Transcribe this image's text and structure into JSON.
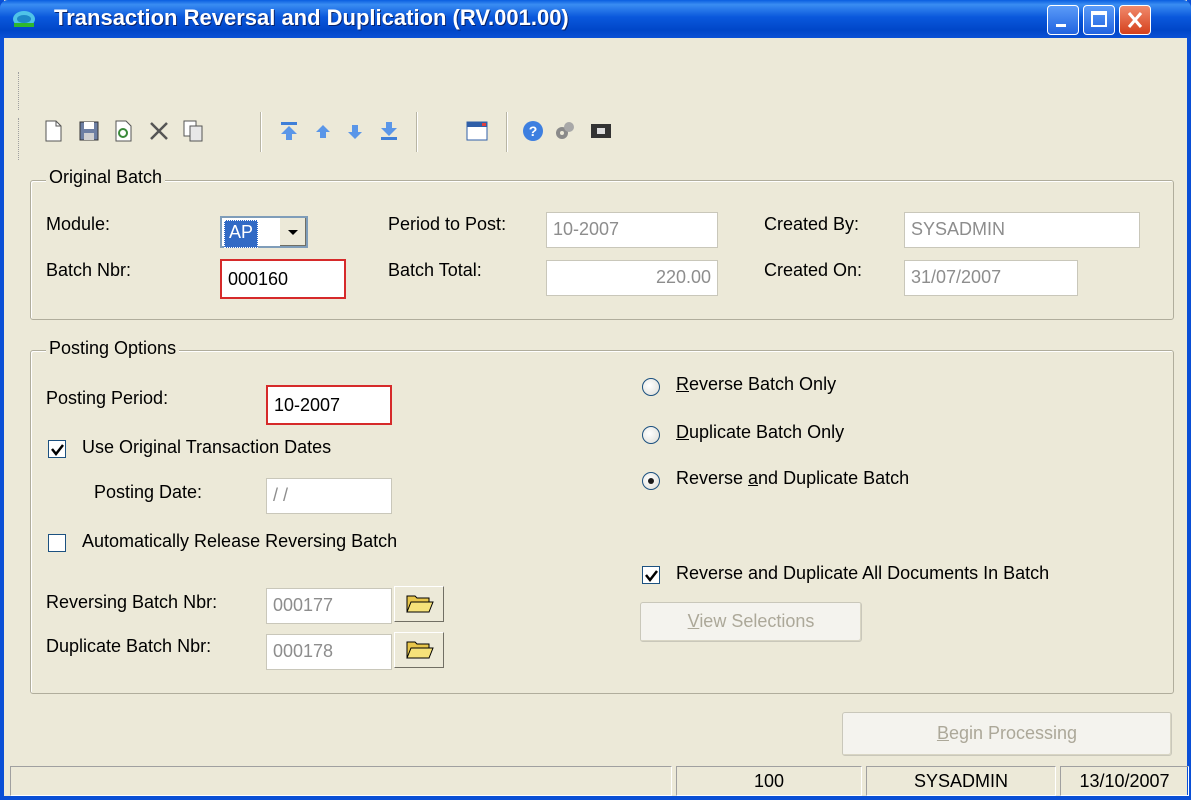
{
  "window": {
    "title": "Transaction Reversal and Duplication (RV.001.00)"
  },
  "toolbar": {
    "icons": [
      "new-icon",
      "save-icon",
      "refresh-icon",
      "delete-icon",
      "copy-icon",
      "first-record-icon",
      "previous-record-icon",
      "next-record-icon",
      "last-record-icon",
      "window-icon",
      "help-icon",
      "tools-icon",
      "screen-icon"
    ]
  },
  "original_batch": {
    "legend": "Original Batch",
    "module_label": "Module:",
    "module_value": "AP",
    "batch_nbr_label": "Batch Nbr:",
    "batch_nbr_value": "000160",
    "period_to_post_label": "Period to Post:",
    "period_to_post_value": "10-2007",
    "batch_total_label": "Batch Total:",
    "batch_total_value": "220.00",
    "created_by_label": "Created By:",
    "created_by_value": "SYSADMIN",
    "created_on_label": "Created On:",
    "created_on_value": "31/07/2007"
  },
  "posting_options": {
    "legend": "Posting Options",
    "posting_period_label": "Posting Period:",
    "posting_period_value": "10-2007",
    "use_original_dates": {
      "label": "Use Original Transaction Dates",
      "checked": true
    },
    "posting_date_label": "Posting Date:",
    "posting_date_value": " / /",
    "auto_release": {
      "label": "Automatically Release Reversing Batch",
      "checked": false
    },
    "reversing_batch_label": "Reversing Batch Nbr:",
    "reversing_batch_value": "000177",
    "duplicate_batch_label": "Duplicate Batch Nbr:",
    "duplicate_batch_value": "000178",
    "radio_reverse_only": {
      "label_u": "R",
      "label_rest": "everse Batch Only",
      "selected": false
    },
    "radio_duplicate_only": {
      "label_u": "D",
      "label_rest": "uplicate Batch Only",
      "selected": false
    },
    "radio_reverse_and_duplicate": {
      "label_pre": "Reverse ",
      "label_u": "a",
      "label_rest": "nd Duplicate Batch",
      "selected": true
    },
    "all_documents": {
      "label": "Reverse and Duplicate All Documents In Batch",
      "checked": true
    },
    "view_selections": {
      "label_u": "V",
      "label_rest": "iew Selections"
    }
  },
  "begin_processing": {
    "label_u": "B",
    "label_rest": "egin Processing"
  },
  "statusbar": {
    "panel1": "",
    "panel2": "100",
    "panel3": "SYSADMIN",
    "panel4": "13/10/2007"
  }
}
